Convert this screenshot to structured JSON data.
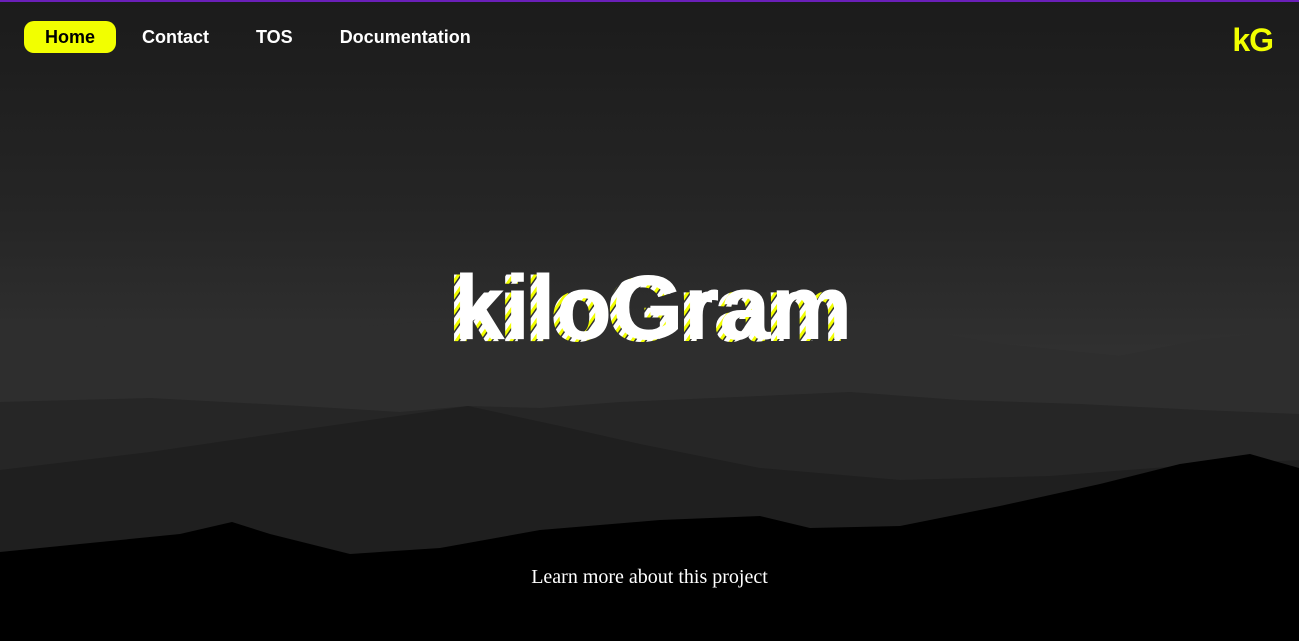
{
  "nav": {
    "items": [
      {
        "label": "Home",
        "active": true
      },
      {
        "label": "Contact",
        "active": false
      },
      {
        "label": "TOS",
        "active": false
      },
      {
        "label": "Documentation",
        "active": false
      }
    ]
  },
  "logo": {
    "text": "kG"
  },
  "hero": {
    "title": "kiloGram"
  },
  "footer": {
    "link_text": "Learn more about this project"
  },
  "colors": {
    "accent": "#f2ff00",
    "top_border": "#6a1fb8",
    "background": "#000000",
    "text": "#ffffff"
  }
}
